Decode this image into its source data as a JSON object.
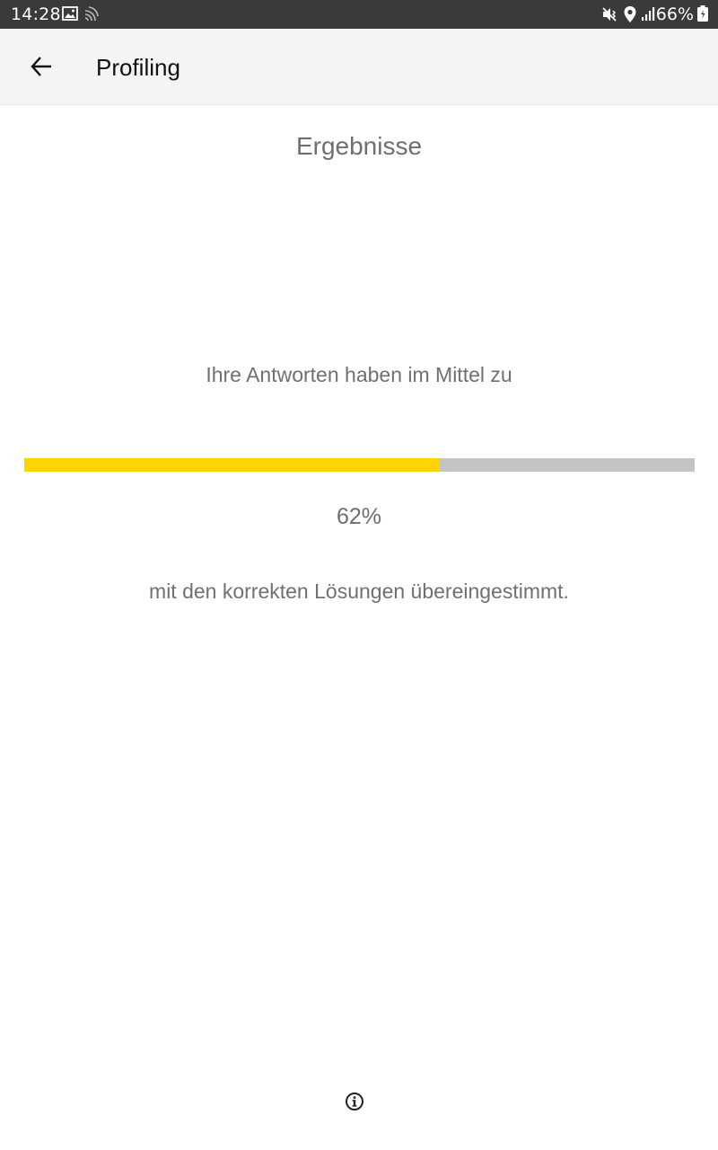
{
  "status_bar": {
    "time": "14:28",
    "battery": "66%",
    "icons": [
      "image-icon",
      "cast-icon",
      "mute-vibrate-icon",
      "location-icon",
      "signal-icon",
      "battery-icon"
    ]
  },
  "app_bar": {
    "title": "Profiling",
    "back_icon": "arrow-left-icon"
  },
  "results": {
    "heading": "Ergebnisse",
    "intro": "Ihre Antworten haben im Mittel zu",
    "progress_fraction": 0.62,
    "percent_label": "62%",
    "outro": "mit den korrekten Lösungen übereingestimmt."
  },
  "footer": {
    "info_icon": "info-icon"
  },
  "colors": {
    "progress_fill": "#ffd400",
    "progress_track": "#c4c4c4",
    "status_bar": "#3a3a3a",
    "app_bar": "#f4f4f4"
  }
}
